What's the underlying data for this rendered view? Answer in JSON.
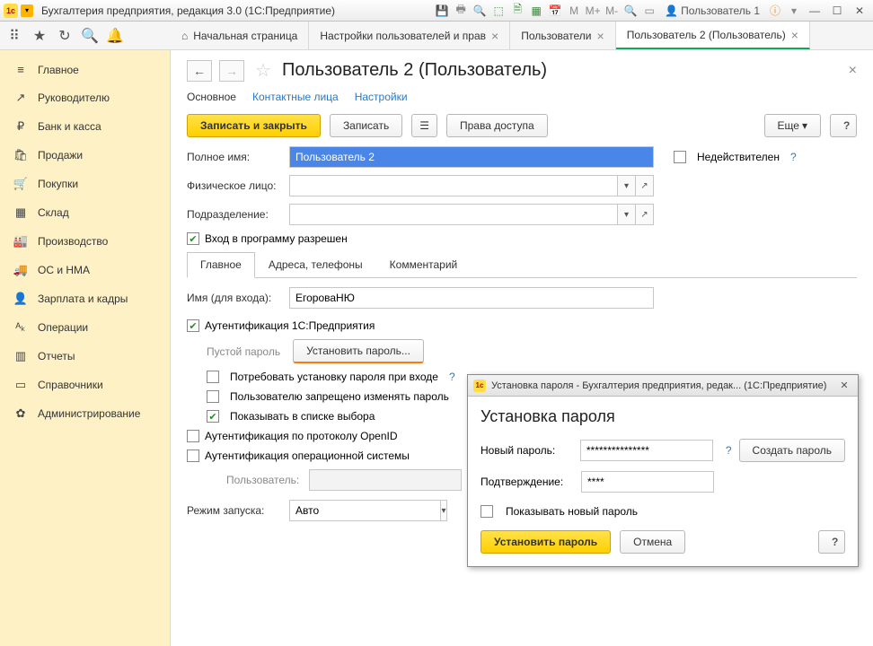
{
  "titlebar": {
    "app_title": "Бухгалтерия предприятия, редакция 3.0  (1С:Предприятие)",
    "user": "Пользователь 1"
  },
  "top_tabs": {
    "home": "Начальная страница",
    "t1": "Настройки пользователей и прав",
    "t2": "Пользователи",
    "t3": "Пользователь 2 (Пользователь)"
  },
  "sidebar": [
    {
      "icon": "≡",
      "label": "Главное"
    },
    {
      "icon": "↗",
      "label": "Руководителю"
    },
    {
      "icon": "₽",
      "label": "Банк и касса"
    },
    {
      "icon": "🛍",
      "label": "Продажи"
    },
    {
      "icon": "🛒",
      "label": "Покупки"
    },
    {
      "icon": "▦",
      "label": "Склад"
    },
    {
      "icon": "🏭",
      "label": "Производство"
    },
    {
      "icon": "🚚",
      "label": "ОС и НМА"
    },
    {
      "icon": "👤",
      "label": "Зарплата и кадры"
    },
    {
      "icon": "ᴬₖ",
      "label": "Операции"
    },
    {
      "icon": "▥",
      "label": "Отчеты"
    },
    {
      "icon": "▭",
      "label": "Справочники"
    },
    {
      "icon": "✿",
      "label": "Администрирование"
    }
  ],
  "page": {
    "title": "Пользователь 2 (Пользователь)",
    "subtabs": {
      "main": "Основное",
      "contacts": "Контактные лица",
      "settings": "Настройки"
    },
    "buttons": {
      "save_close": "Записать и закрыть",
      "save": "Записать",
      "rights": "Права доступа",
      "more": "Еще",
      "help": "?"
    },
    "fields": {
      "fullname_label": "Полное имя:",
      "fullname_value": "Пользователь 2",
      "inactive_label": "Недействителен",
      "person_label": "Физическое лицо:",
      "dept_label": "Подразделение:",
      "login_allowed": "Вход в программу разрешен"
    },
    "inner_tabs": {
      "main": "Главное",
      "addr": "Адреса, телефоны",
      "comment": "Комментарий"
    },
    "auth": {
      "login_label": "Имя (для входа):",
      "login_value": "ЕгороваНЮ",
      "auth1c": "Аутентификация 1С:Предприятия",
      "empty_pwd": "Пустой пароль",
      "set_pwd": "Установить пароль...",
      "require_pwd": "Потребовать установку пароля при входе",
      "no_change": "Пользователю запрещено изменять пароль",
      "show_list": "Показывать в списке выбора",
      "openid": "Аутентификация по протоколу OpenID",
      "os_auth": "Аутентификация операционной системы",
      "os_user": "Пользователь:",
      "run_mode_label": "Режим запуска:",
      "run_mode_value": "Авто"
    }
  },
  "dialog": {
    "title": "Установка пароля - Бухгалтерия предприятия, редак...  (1С:Предприятие)",
    "heading": "Установка пароля",
    "new_pwd_label": "Новый пароль:",
    "new_pwd_value": "***************",
    "confirm_label": "Подтверждение:",
    "confirm_value": "****",
    "gen_btn": "Создать пароль",
    "show_pwd": "Показывать новый пароль",
    "set_btn": "Установить пароль",
    "cancel": "Отмена",
    "help": "?"
  }
}
